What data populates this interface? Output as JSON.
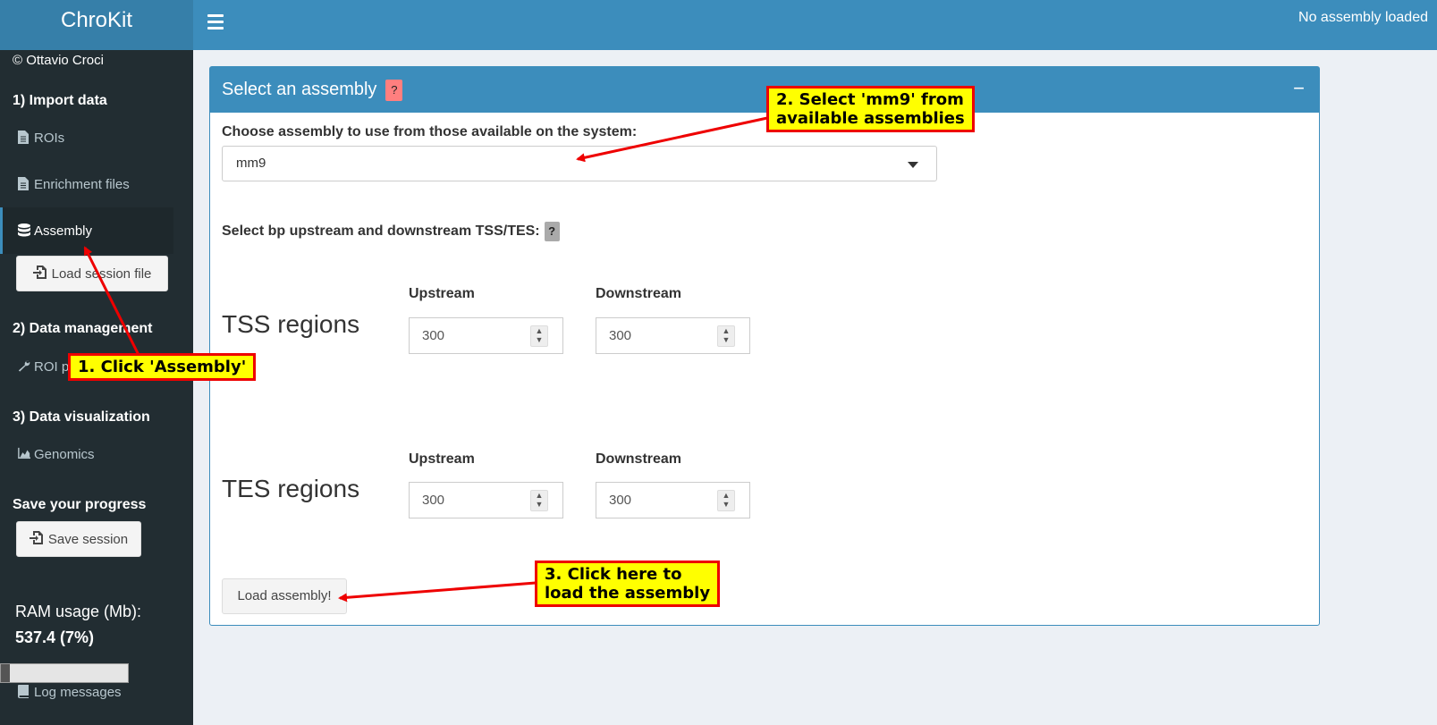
{
  "app": {
    "title": "ChroKit",
    "status": "No assembly loaded"
  },
  "sidebar": {
    "copyright": "© Ottavio Croci",
    "sections": [
      "1) Import data",
      "2) Data management",
      "3) Data visualization"
    ],
    "items": {
      "rois": "ROIs",
      "enrichment": "Enrichment files",
      "assembly": "Assembly",
      "roi_partial": "ROI p",
      "genomics": "Genomics",
      "log": "Log messages"
    },
    "load_session": "Load session file",
    "save_title": "Save your progress",
    "save_session": "Save session",
    "ram_label": "RAM usage (Mb):",
    "ram_value": "537.4 (7%)",
    "ram_fraction": 0.07
  },
  "box": {
    "title": "Select an assembly",
    "help": "?",
    "collapse": "−",
    "choose_label": "Choose assembly to use from those available on the system:",
    "selected_assembly": "mm9",
    "bp_label": "Select bp upstream and downstream TSS/TES:",
    "bp_help": "?",
    "tss": {
      "title": "TSS regions",
      "upstream_label": "Upstream",
      "downstream_label": "Downstream",
      "upstream": "300",
      "downstream": "300"
    },
    "tes": {
      "title": "TES regions",
      "upstream_label": "Upstream",
      "downstream_label": "Downstream",
      "upstream": "300",
      "downstream": "300"
    },
    "load_button": "Load assembly!"
  },
  "annotations": {
    "step1": "1. Click 'Assembly'",
    "step2_line1": "2. Select 'mm9' from",
    "step2_line2": "available assemblies",
    "step3_line1": "3. Click here to",
    "step3_line2": "load the assembly",
    "color": "#ff0000",
    "highlight": "#ffff00"
  }
}
